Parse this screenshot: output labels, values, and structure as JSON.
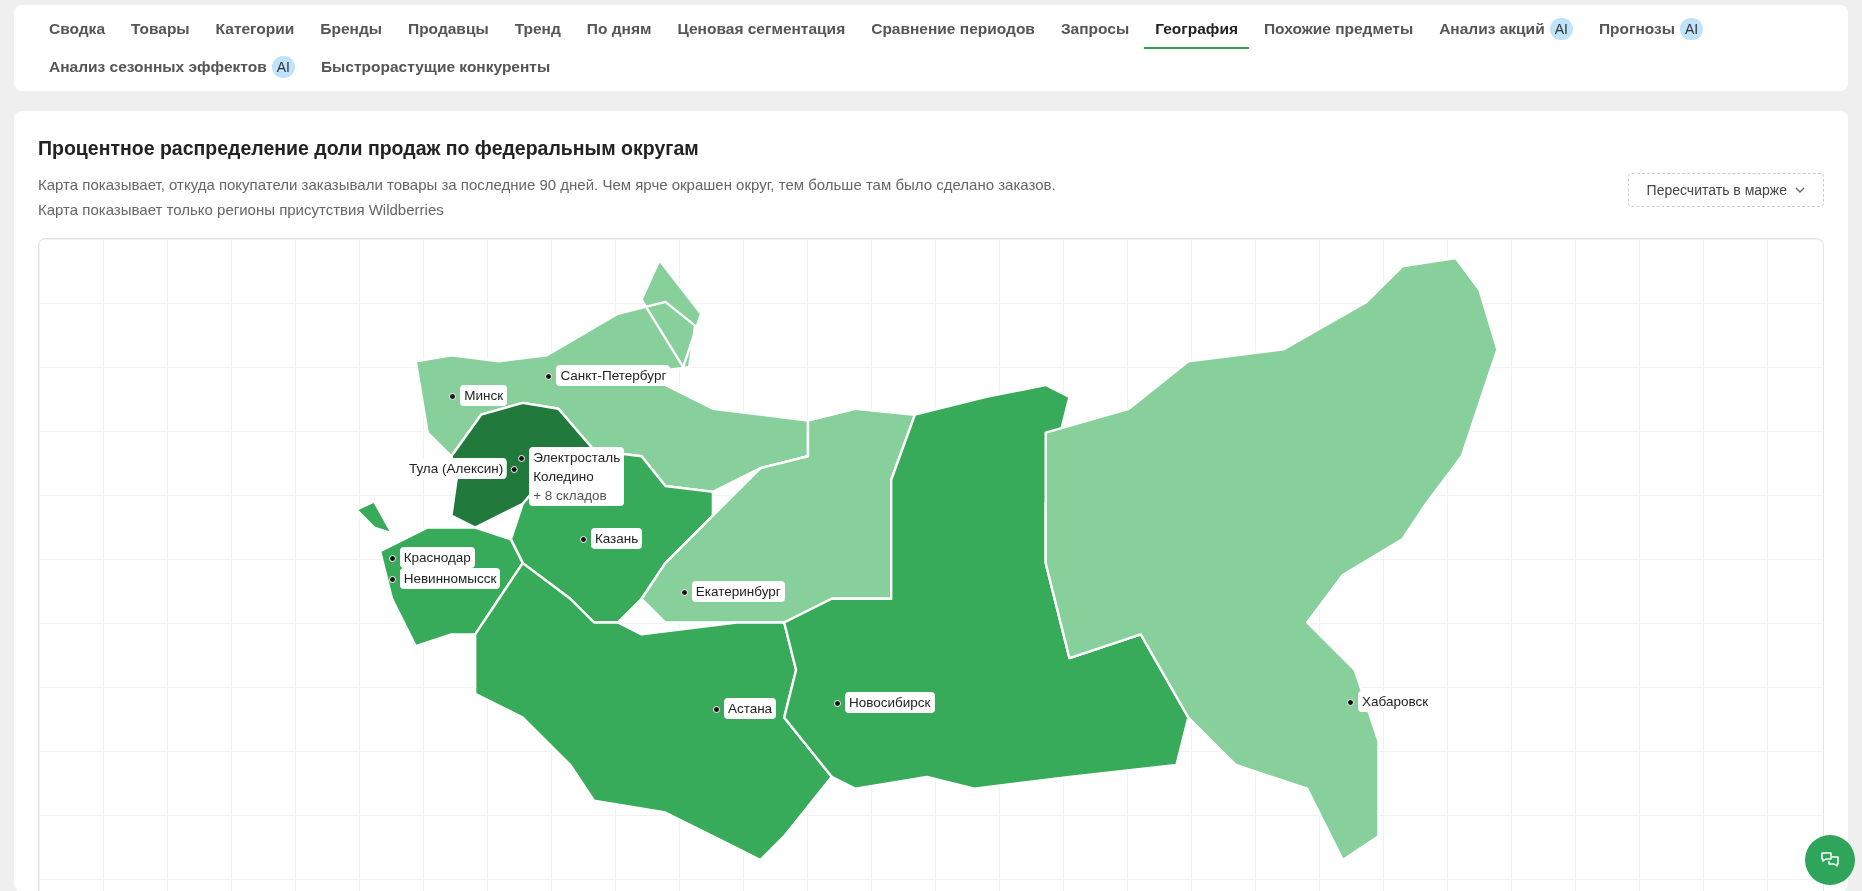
{
  "tabs": [
    {
      "label": "Сводка",
      "selected": false
    },
    {
      "label": "Товары",
      "selected": false
    },
    {
      "label": "Категории",
      "selected": false
    },
    {
      "label": "Бренды",
      "selected": false
    },
    {
      "label": "Продавцы",
      "selected": false
    },
    {
      "label": "Тренд",
      "selected": false
    },
    {
      "label": "По дням",
      "selected": false
    },
    {
      "label": "Ценовая сегментация",
      "selected": false
    },
    {
      "label": "Сравнение периодов",
      "selected": false
    },
    {
      "label": "Запросы",
      "selected": false
    },
    {
      "label": "География",
      "selected": true
    },
    {
      "label": "Похожие предметы",
      "selected": false
    },
    {
      "label": "Анализ акций",
      "selected": false,
      "badge": "AI"
    },
    {
      "label": "Прогнозы",
      "selected": false,
      "badge": "AI"
    },
    {
      "label": "Анализ сезонных эффектов",
      "selected": false,
      "badge": "AI"
    },
    {
      "label": "Быстрорастущие конкуренты",
      "selected": false
    }
  ],
  "panel": {
    "title": "Процентное распределение доли продаж по федеральным округам",
    "description": [
      "Карта показывает, откуда покупатели заказывали товары за последние 90 дней. Чем ярче окрашен округ, тем больше там было сделано заказов.",
      "Карта показывает только регионы присутствия Wildberries"
    ],
    "recalc_button": "Пересчитать в марже"
  },
  "map": {
    "regions": [
      {
        "color": "#88d09b"
      },
      {
        "color": "#217a3c"
      },
      {
        "color": "#38ab5b"
      },
      {
        "color": "#38ab5b"
      },
      {
        "color": "#88d09b"
      },
      {
        "color": "#38ab5b"
      },
      {
        "color": "#38ab5b"
      },
      {
        "color": "#88d09b"
      }
    ],
    "cities": [
      {
        "lines": [
          "Минск"
        ]
      },
      {
        "lines": [
          "Санкт-Петербург"
        ]
      },
      {
        "lines": [
          "Электросталь",
          "Коледино",
          "+ 8 складов"
        ]
      },
      {
        "lines": [
          "Тула (Алексин)"
        ]
      },
      {
        "lines": [
          "Казань"
        ]
      },
      {
        "lines": [
          "Краснодар"
        ]
      },
      {
        "lines": [
          "Невинномысск"
        ]
      },
      {
        "lines": [
          "Екатеринбург"
        ]
      },
      {
        "lines": [
          "Астана"
        ]
      },
      {
        "lines": [
          "Новосибирск"
        ]
      },
      {
        "lines": [
          "Хабаровск"
        ]
      }
    ]
  }
}
